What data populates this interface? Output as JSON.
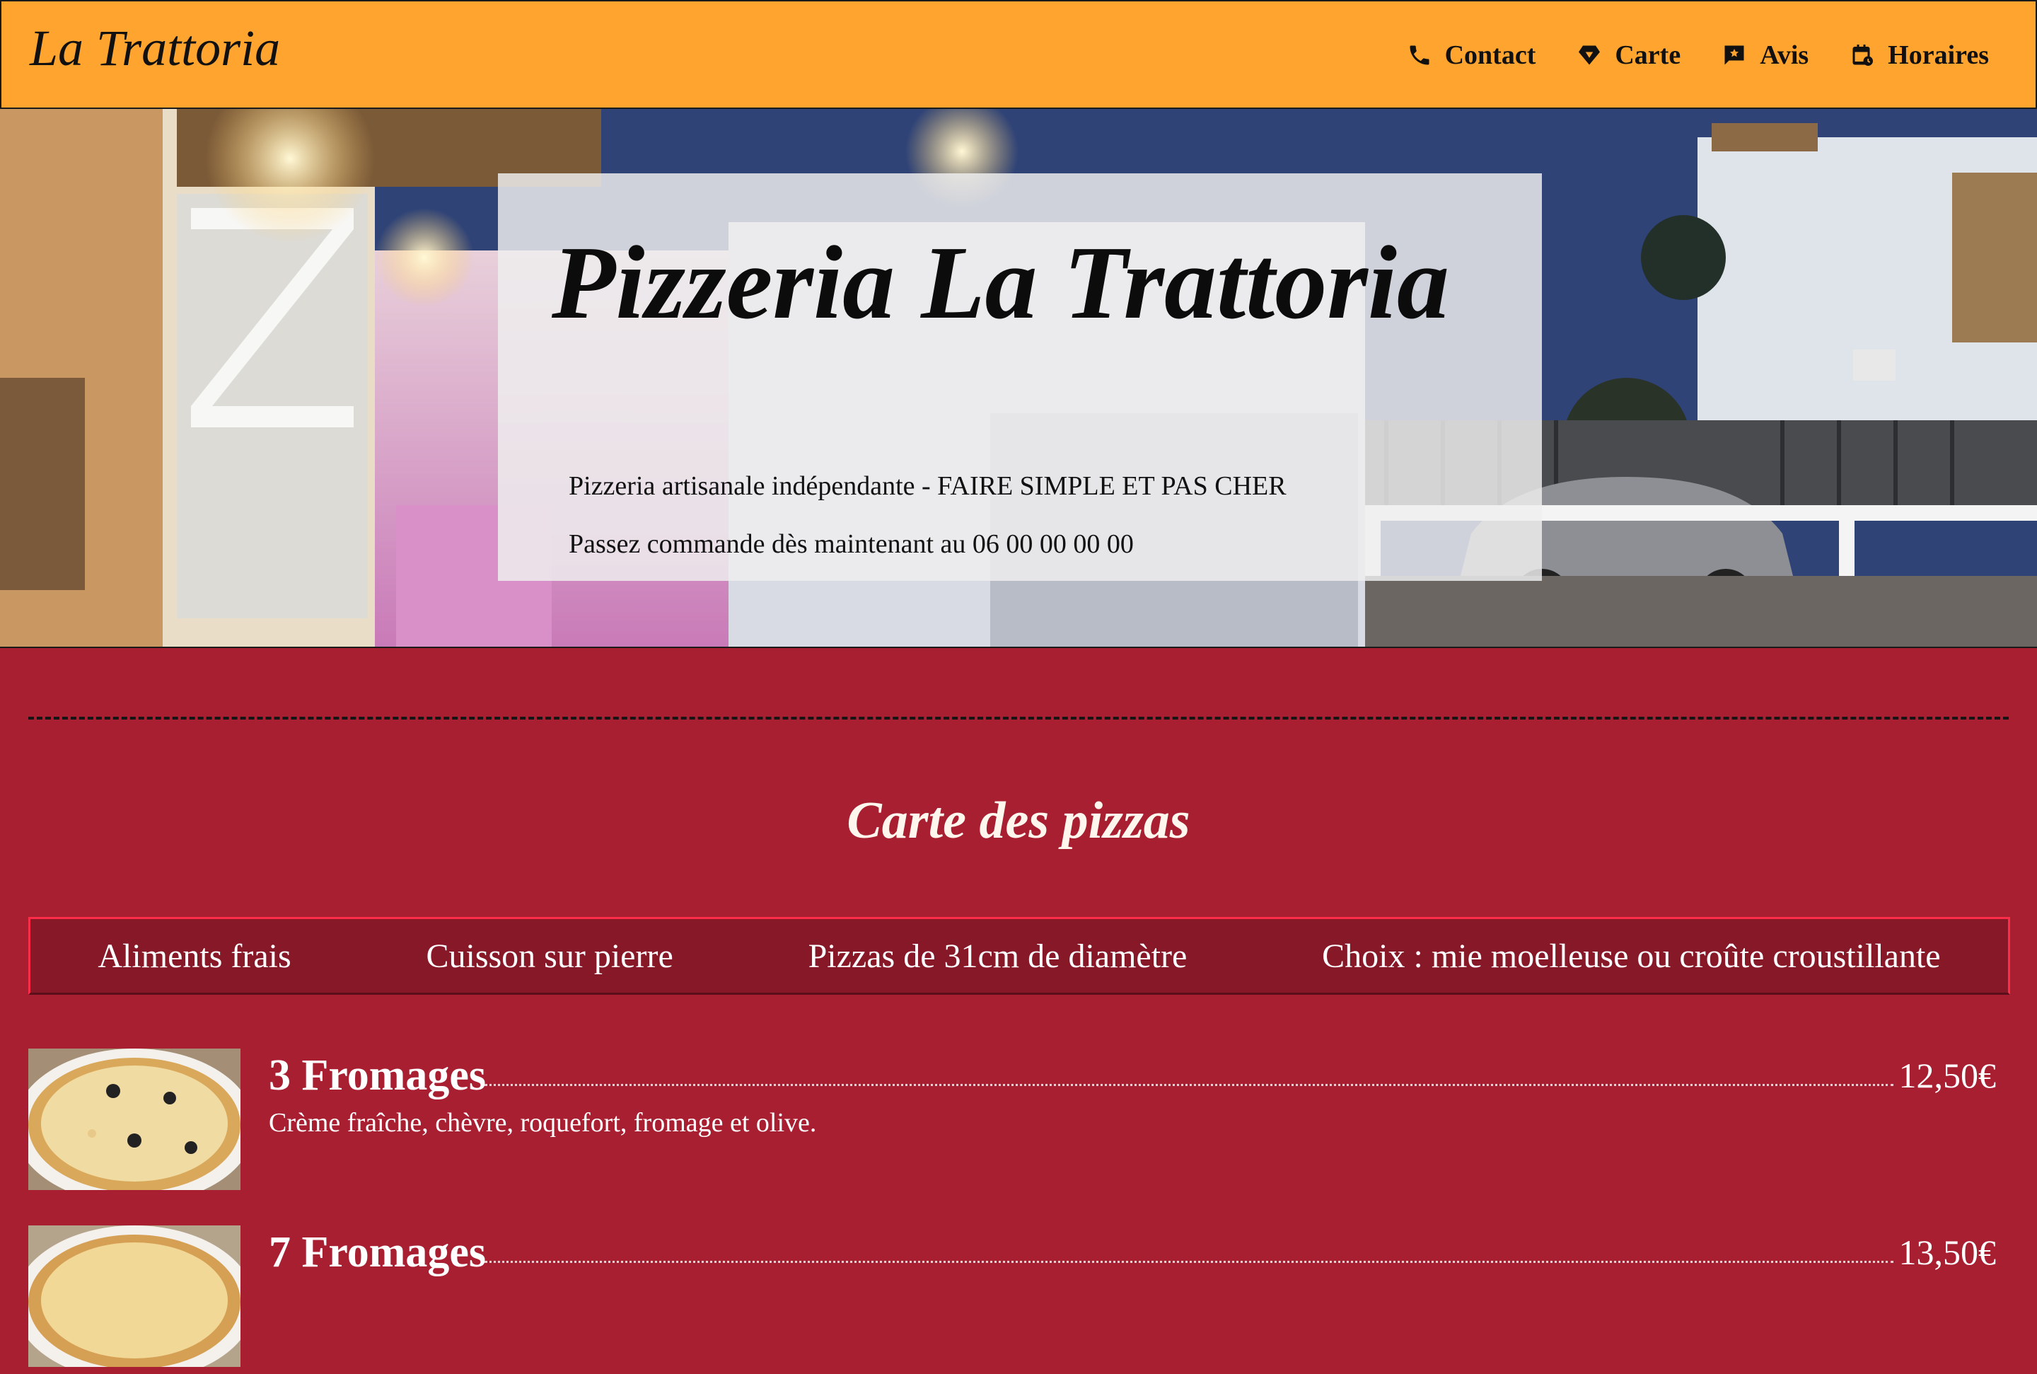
{
  "header": {
    "brand": "La Trattoria",
    "nav": [
      {
        "label": "Contact",
        "icon": "phone-icon"
      },
      {
        "label": "Carte",
        "icon": "diamond-icon"
      },
      {
        "label": "Avis",
        "icon": "review-icon"
      },
      {
        "label": "Horaires",
        "icon": "calendar-clock-icon"
      }
    ]
  },
  "hero": {
    "title": "Pizzeria La Trattoria",
    "tagline": "Pizzeria artisanale indépendante - FAIRE SIMPLE ET PAS CHER",
    "order_line": "Passez commande dès maintenant au 06 00 00 00 00"
  },
  "menu": {
    "title": "Carte des pizzas",
    "features": [
      "Aliments frais",
      "Cuisson sur pierre",
      "Pizzas de 31cm de diamètre",
      "Choix : mie moelleuse ou croûte croustillante"
    ],
    "pizzas": [
      {
        "name": "3 Fromages",
        "price": "12,50€",
        "description": "Crème fraîche, chèvre, roquefort, fromage et olive."
      },
      {
        "name": "7 Fromages",
        "price": "13,50€",
        "description": ""
      }
    ]
  },
  "colors": {
    "header_bg": "#ffa42e",
    "page_bg": "#a81f32",
    "feature_bar_bg": "#861828",
    "feature_bar_border": "#ff2d48"
  }
}
